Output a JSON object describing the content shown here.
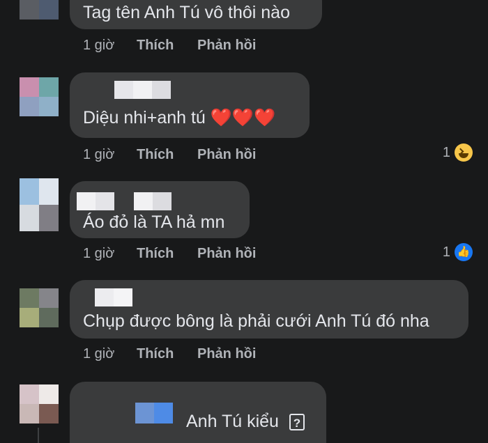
{
  "comments": [
    {
      "text": "Tag tên Anh Tú vô thôi nào",
      "time": "1 giờ",
      "like": "Thích",
      "reply": "Phản hồi",
      "reaction_count": ""
    },
    {
      "text": "Diệu nhi+anh tú",
      "hearts": "❤️❤️❤️",
      "time": "1 giờ",
      "like": "Thích",
      "reply": "Phản hồi",
      "reaction_count": "1",
      "reaction_icon": "haha-icon"
    },
    {
      "text": "Áo đỏ là TA hả mn",
      "time": "1 giờ",
      "like": "Thích",
      "reply": "Phản hồi",
      "reaction_count": "1",
      "reaction_icon": "like-icon"
    },
    {
      "text": "Chụp được bông là phải cưới Anh Tú đó nha",
      "time": "1 giờ",
      "like": "Thích",
      "reply": "Phản hồi",
      "reaction_count": ""
    },
    {
      "text": "Anh Tú kiểu",
      "unknown_glyph": "?"
    }
  ],
  "colors": {
    "background": "#18191a",
    "bubble": "#3a3b3c",
    "text": "#e4e6eb",
    "meta": "#b0b3b8",
    "like_blue": "#1877f2",
    "haha_yellow": "#f7c64a",
    "heart_red": "#f02849"
  }
}
